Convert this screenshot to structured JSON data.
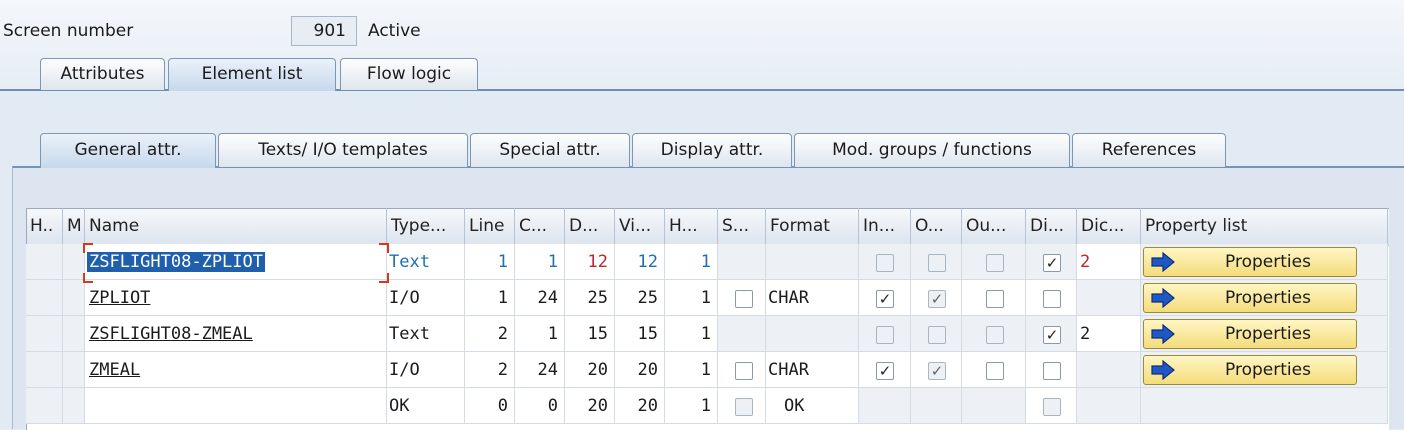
{
  "header": {
    "screen_number_label": "Screen number",
    "screen_number_value": "901",
    "status": "Active"
  },
  "outer_tabs": [
    {
      "label": "Attributes",
      "active": false
    },
    {
      "label": "Element list",
      "active": true
    },
    {
      "label": "Flow logic",
      "active": false
    }
  ],
  "inner_tabs": [
    {
      "label": "General attr.",
      "active": true
    },
    {
      "label": "Texts/ I/O templates",
      "active": false
    },
    {
      "label": "Special attr.",
      "active": false
    },
    {
      "label": "Display attr.",
      "active": false
    },
    {
      "label": "Mod. groups / functions",
      "active": false
    },
    {
      "label": "References",
      "active": false
    }
  ],
  "table": {
    "columns": [
      "H..",
      "M",
      "Name",
      "Type...",
      "Line",
      "C...",
      "D...",
      "Vi...",
      "H...",
      "S...",
      "Format",
      "In...",
      "O...",
      "Ou...",
      "Di...",
      "Dic...",
      "Property list"
    ],
    "rows": [
      {
        "name": "ZSFLIGHT08-ZPLIOT",
        "type": "Text",
        "line": "1",
        "col": "1",
        "deflen": "12",
        "vislen": "12",
        "height": "1",
        "format": "",
        "dic": "2",
        "property": "Properties"
      },
      {
        "name": "ZPLIOT",
        "type": "I/O",
        "line": "1",
        "col": "24",
        "deflen": "25",
        "vislen": "25",
        "height": "1",
        "format": "CHAR",
        "dic": "",
        "property": "Properties"
      },
      {
        "name": "ZSFLIGHT08-ZMEAL",
        "type": "Text",
        "line": "2",
        "col": "1",
        "deflen": "15",
        "vislen": "15",
        "height": "1",
        "format": "",
        "dic": "2",
        "property": "Properties"
      },
      {
        "name": "ZMEAL",
        "type": "I/O",
        "line": "2",
        "col": "24",
        "deflen": "20",
        "vislen": "20",
        "height": "1",
        "format": "CHAR",
        "dic": "",
        "property": "Properties"
      },
      {
        "name": "",
        "type": "OK",
        "line": "0",
        "col": "0",
        "deflen": "20",
        "vislen": "20",
        "height": "1",
        "format": "OK",
        "dic": "",
        "property": ""
      }
    ]
  },
  "icons": {
    "property_button_icon": "right-arrow-icon"
  },
  "colors": {
    "selection": "#1f5fae",
    "button_bg": "#f4dc7a",
    "active_tab": "#c7d8ec"
  }
}
